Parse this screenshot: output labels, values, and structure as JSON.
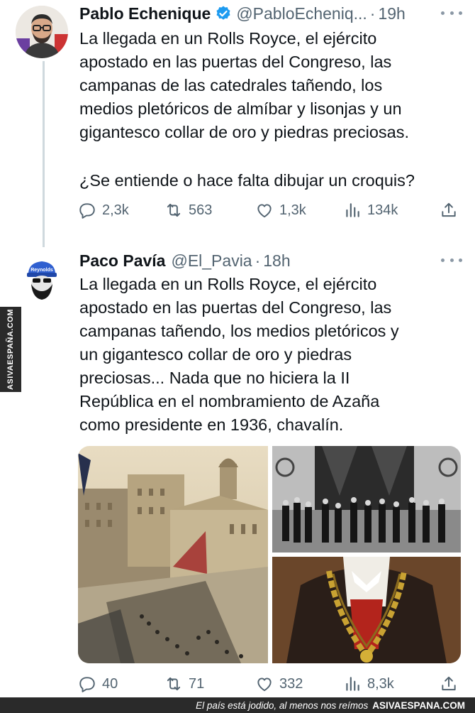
{
  "tweet1": {
    "name": "Pablo Echenique",
    "handle": "@PabloEcheniq...",
    "time": "19h",
    "text": "La llegada en un Rolls Royce, el ejército\napostado en las puertas del Congreso, las\ncampanas de las catedrales tañendo, los\nmedios pletóricos de almíbar y lisonjas y un\ngigantesco collar de oro y piedras preciosas.",
    "question": "¿Se entiende o hace falta dibujar un croquis?",
    "replies": "2,3k",
    "retweets": "563",
    "likes": "1,3k",
    "views": "134k",
    "verified": true
  },
  "tweet2": {
    "name": "Paco Pavía",
    "handle": "@El_Pavia",
    "time": "18h",
    "text": "La llegada en un Rolls Royce, el ejército\napostado en las puertas del Congreso, las\ncampanas tañendo, los medios pletóricos y\nun gigantesco collar de oro y piedras\npreciosas... Nada que no hiciera la II\nRepública en el nombramiento de Azaña\ncomo presidente en 1936, chavalín.",
    "replies": "40",
    "retweets": "71",
    "likes": "332",
    "views": "8,3k",
    "avatar_cap_text": "Reynolds"
  },
  "watermark": {
    "side": "ASIVAESPAÑA.COM",
    "slogan": "El país está jodido, al menos nos reímos",
    "brand": "ASIVAESPANA.COM"
  },
  "icons": {
    "reply": "reply-icon",
    "retweet": "retweet-icon",
    "like": "heart-icon",
    "views": "views-icon",
    "share": "share-icon",
    "verified": "verified-badge-icon",
    "more": "more-icon"
  },
  "colors": {
    "verified_blue": "#1d9bf0",
    "secondary_text": "#536471",
    "thread_line": "#cfd9de"
  }
}
